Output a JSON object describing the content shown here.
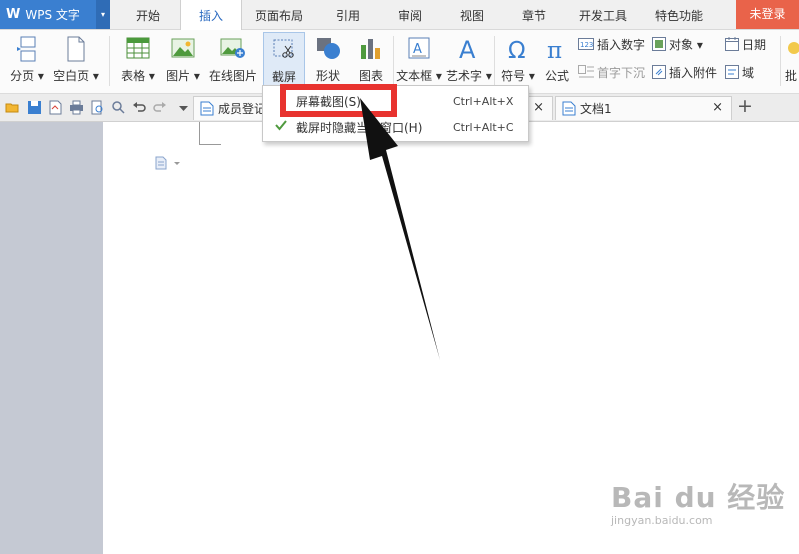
{
  "app": {
    "logo": "W",
    "name": "WPS 文字",
    "menu_arrow": "▾"
  },
  "menu_tabs": [
    "开始",
    "插入",
    "页面布局",
    "引用",
    "审阅",
    "视图",
    "章节",
    "开发工具",
    "特色功能"
  ],
  "login": "未登录",
  "ribbon": {
    "page_break": "分页",
    "blank_page": "空白页",
    "table": "表格",
    "picture": "图片",
    "online_picture": "在线图片",
    "screenshot": "截屏",
    "shape": "形状",
    "chart": "图表",
    "text_box": "文本框",
    "word_art": "艺术字",
    "symbol": "符号",
    "formula": "公式",
    "insert_number": "插入数字",
    "drop_cap": "首字下沉",
    "object": "对象",
    "insert_attachment": "插入附件",
    "date": "日期",
    "field": "域",
    "batch": "批"
  },
  "doc_tabs": [
    {
      "title": "成员登记",
      "close": "×"
    },
    {
      "title": "文档1",
      "close": "×"
    }
  ],
  "add_tab": "+",
  "dropdown": {
    "screen_capture": "屏幕截图(S)",
    "screen_capture_shortcut": "Ctrl+Alt+X",
    "hide_window": "截屏时隐藏当前窗口(H)",
    "hide_window_shortcut": "Ctrl+Alt+C"
  },
  "watermark": {
    "brand": "Bai du 经验",
    "url": "jingyan.baidu.com"
  },
  "colors": {
    "accent": "#3a7fd0",
    "login": "#e9634a",
    "highlight_box": "#e8332f"
  }
}
